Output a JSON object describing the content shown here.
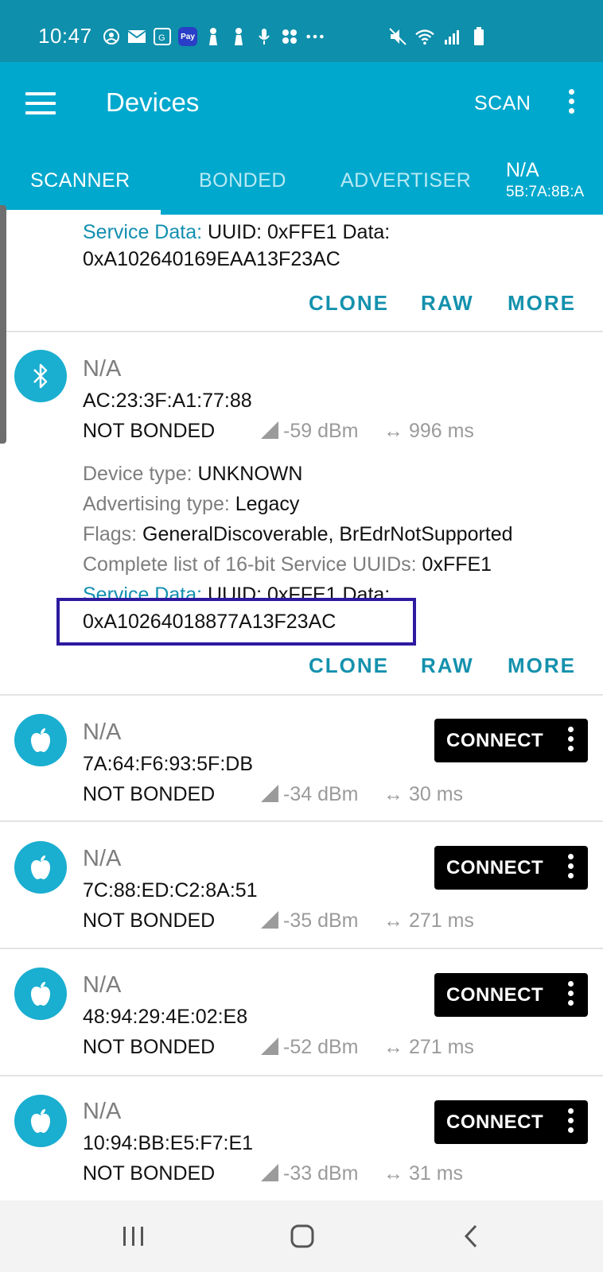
{
  "status_bar": {
    "time": "10:47",
    "pay_badge": "Pay"
  },
  "app_bar": {
    "title": "Devices",
    "scan_label": "SCAN"
  },
  "tabs": [
    {
      "label": "SCANNER",
      "active": true
    },
    {
      "label": "BONDED",
      "active": false
    },
    {
      "label": "ADVERTISER",
      "active": false
    }
  ],
  "tab_extra": {
    "name": "N/A",
    "address": "5B:7A:8B:A"
  },
  "partial_entry": {
    "service_data_label": "Service Data:",
    "service_data_value": "UUID: 0xFFE1 Data:",
    "service_data_payload": "0xA102640169EAA13F23AC"
  },
  "actions": {
    "clone": "CLONE",
    "raw": "RAW",
    "more": "MORE"
  },
  "expanded_device": {
    "name": "N/A",
    "address": "AC:23:3F:A1:77:88",
    "bond_state": "NOT BONDED",
    "rssi": "-59 dBm",
    "interval": "996 ms",
    "device_type_label": "Device type:",
    "device_type_value": "UNKNOWN",
    "adv_type_label": "Advertising type:",
    "adv_type_value": "Legacy",
    "flags_label": "Flags:",
    "flags_value": "GeneralDiscoverable, BrEdrNotSupported",
    "uuids_label": "Complete list of 16-bit Service UUIDs:",
    "uuids_value": "0xFFE1",
    "service_data_label": "Service Data:",
    "service_data_value": "UUID: 0xFFE1 Data:",
    "service_data_payload": "0xA10264018877A13F23AC"
  },
  "devices": [
    {
      "name": "N/A",
      "address": "7A:64:F6:93:5F:DB",
      "bond_state": "NOT BONDED",
      "rssi": "-34 dBm",
      "interval": "30 ms",
      "connect_label": "CONNECT"
    },
    {
      "name": "N/A",
      "address": "7C:88:ED:C2:8A:51",
      "bond_state": "NOT BONDED",
      "rssi": "-35 dBm",
      "interval": "271 ms",
      "connect_label": "CONNECT"
    },
    {
      "name": "N/A",
      "address": "48:94:29:4E:02:E8",
      "bond_state": "NOT BONDED",
      "rssi": "-52 dBm",
      "interval": "271 ms",
      "connect_label": "CONNECT"
    },
    {
      "name": "N/A",
      "address": "10:94:BB:E5:F7:E1",
      "bond_state": "NOT BONDED",
      "rssi": "-33 dBm",
      "interval": "31 ms",
      "connect_label": "CONNECT"
    }
  ],
  "colors": {
    "status_bar": "#0e8fab",
    "app_bar": "#00a8cd",
    "accent": "#1491ad",
    "avatar": "#1aaed0",
    "highlight_box": "#2d1aa0"
  },
  "icons": {
    "expanded_device_avatar": "bluetooth-icon",
    "device_avatar": "apple-icon"
  }
}
